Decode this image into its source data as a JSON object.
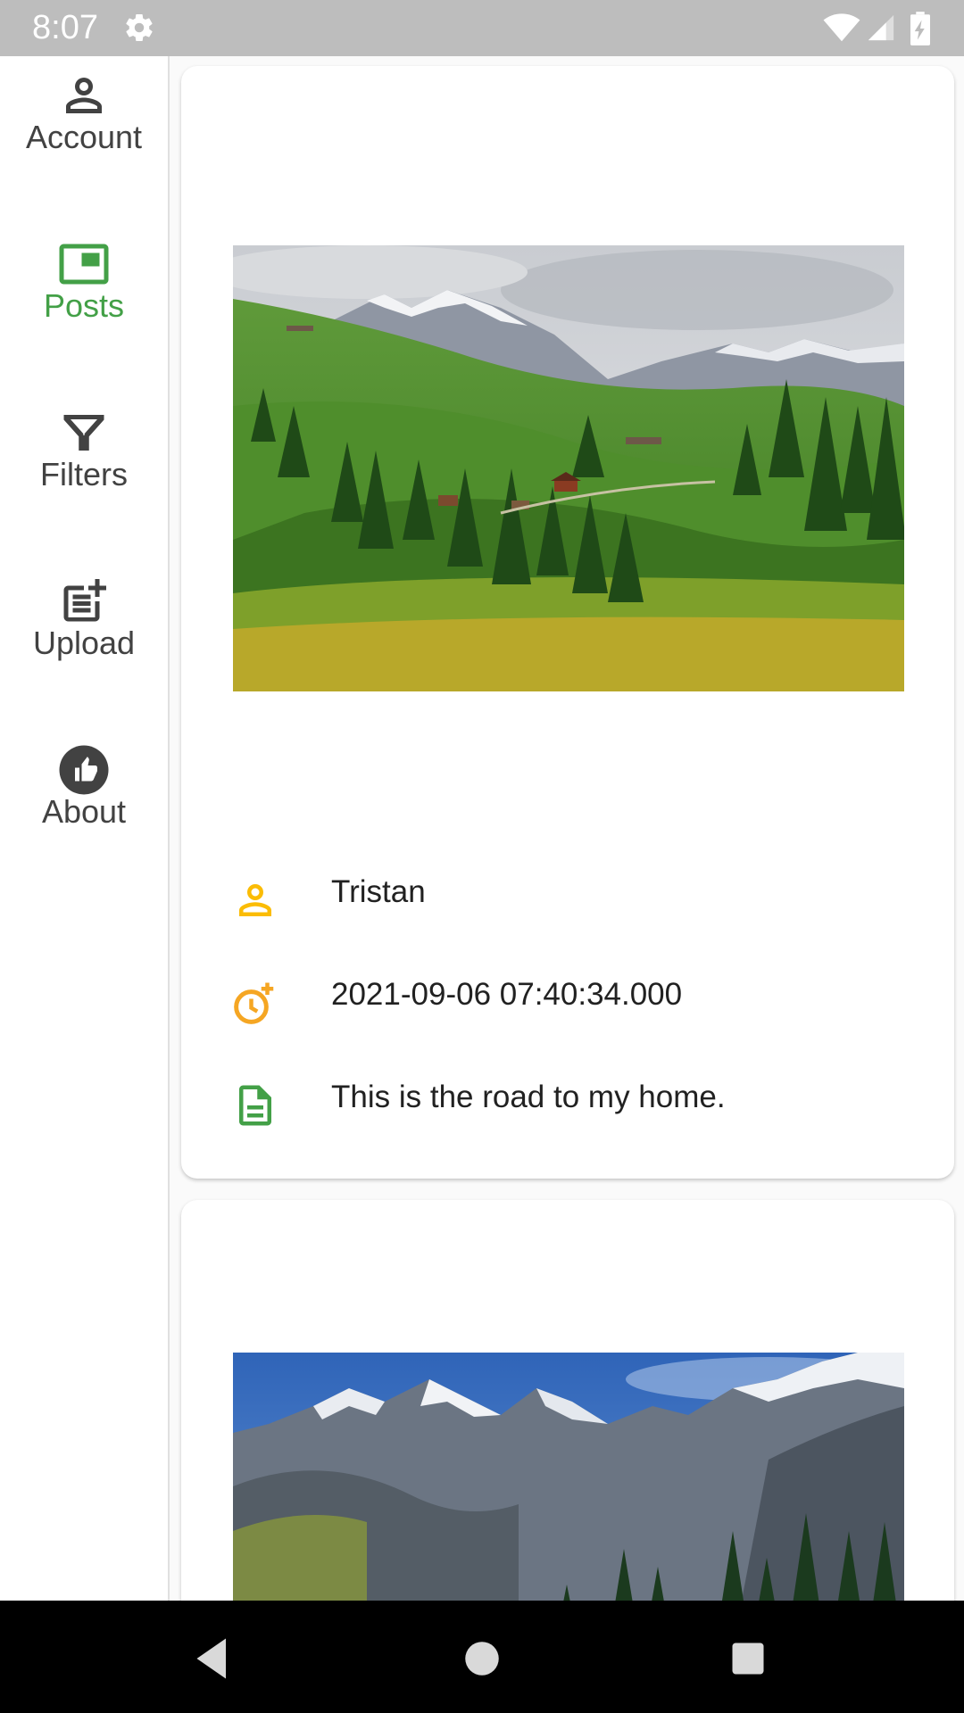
{
  "status_bar": {
    "time": "8:07"
  },
  "nav_rail": {
    "items": [
      {
        "label": "Account",
        "icon": "person-outline-icon",
        "active": false
      },
      {
        "label": "Posts",
        "icon": "posts-icon",
        "active": true
      },
      {
        "label": "Filters",
        "icon": "filter-icon",
        "active": false
      },
      {
        "label": "Upload",
        "icon": "post-add-icon",
        "active": false
      },
      {
        "label": "About",
        "icon": "thumb-up-circle-icon",
        "active": false
      }
    ],
    "active_color": "#43a047"
  },
  "posts": [
    {
      "image": "alpine-meadow-with-chalets-photo",
      "user": "Tristan",
      "timestamp": "2021-09-06 07:40:34.000",
      "description": "This is the road to my home."
    },
    {
      "image": "rocky-snow-mountains-photo"
    }
  ],
  "colors": {
    "user_icon": "#fbbc05",
    "time_icon": "#f5a623",
    "desc_icon": "#43a047"
  },
  "system_nav": [
    "back-icon",
    "home-icon",
    "recents-icon"
  ]
}
